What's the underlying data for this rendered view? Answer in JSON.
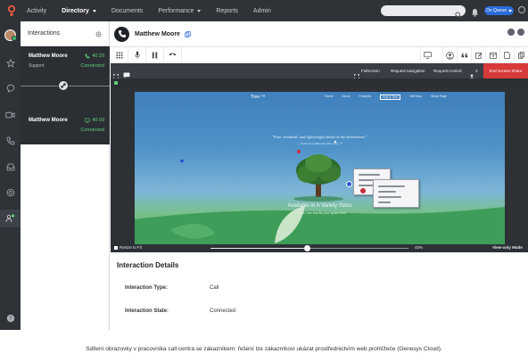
{
  "topbar": {
    "nav": [
      "Activity",
      "Directory",
      "Documents",
      "Performance",
      "Reports",
      "Admin"
    ],
    "active_nav": "Directory",
    "queue_label": "On Queue"
  },
  "interactions": {
    "title": "Interactions",
    "calls": [
      {
        "name": "Matthew Moore",
        "sub": "Support",
        "time": "40:29",
        "state": "Connected"
      },
      {
        "name": "Matthew Moore",
        "sub": "",
        "time": "40:09",
        "state": "Connected"
      }
    ]
  },
  "contact": {
    "name": "Matthew Moore"
  },
  "share_bar": {
    "fullscreen": "Fullscreen",
    "request_navigation": "Request navigation",
    "request_control": "Request control",
    "participants": "2",
    "end_share": "End Screen Share"
  },
  "webpage": {
    "brand": "Tree ™",
    "links": [
      "Home",
      "About",
      "Features",
      "Buy a Tree",
      "Sell Now",
      "Show Page"
    ],
    "quote": "\"Pure, beautiful, and lightweight ahead of the alternatives.\"",
    "quote_attr": "— Trees is nothing else like Tree ™",
    "title": "Available in A Variety Sizes",
    "subtitle": "Pick the Tree that fits your space best"
  },
  "viewer": {
    "resize_to_fit": "Resize to Fit",
    "zoom": "45%",
    "zoom_fraction": 0.49,
    "view_mode": "View-only Mode"
  },
  "details": {
    "title": "Interaction Details",
    "rows": [
      {
        "label": "Interaction Type:",
        "value": "Call"
      },
      {
        "label": "Interaction State:",
        "value": "Connected"
      }
    ]
  },
  "caption": "Sdílení obrazovky v pracovníka call centra se zákazníkem: řešení lze zákazníkovi ukázat prostřednictvím web prohlížeče (Genesys Cloud).",
  "colors": {
    "accent": "#2a6bd8",
    "connected": "#5fd07a",
    "end_share": "#d73a3a",
    "dark": "#2f3237"
  }
}
